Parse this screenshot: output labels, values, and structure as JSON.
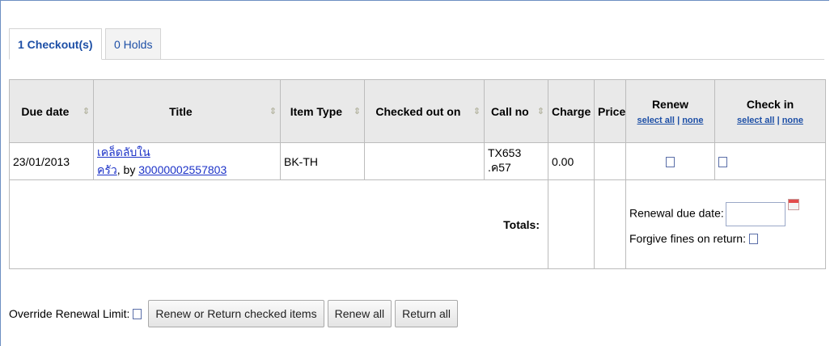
{
  "tabs": [
    {
      "label": "1 Checkout(s)",
      "active": true
    },
    {
      "label": "0 Holds",
      "active": false
    }
  ],
  "table": {
    "headers": {
      "due_date": "Due date",
      "title": "Title",
      "item_type": "Item Type",
      "checked_out_on": "Checked out on",
      "call_no": "Call no",
      "charge": "Charge",
      "price": "Price",
      "renew": "Renew",
      "check_in": "Check in",
      "select_all": "select all",
      "separator": "|",
      "none": "none"
    },
    "rows": [
      {
        "due_date": "23/01/2013",
        "title": "เคล็ดลับในครัว",
        "by": ", by ",
        "barcode": "30000002557803",
        "item_type": "BK-TH",
        "checked_out_on": "",
        "call_no": "TX653 .ค57",
        "charge": "0.00",
        "price": ""
      }
    ],
    "totals_label": "Totals:",
    "renewal_due_date_label": "Renewal due date:",
    "forgive_fines_label": "Forgive fines on return:"
  },
  "footer": {
    "override_label": "Override Renewal Limit:",
    "buttons": {
      "renew_or_return": "Renew or Return checked items",
      "renew_all": "Renew all",
      "return_all": "Return all"
    }
  },
  "icons": {
    "sort": "sort-icon",
    "calendar": "calendar-icon",
    "checkbox": "checkbox"
  },
  "colors": {
    "link": "#1d33c8",
    "tab_text": "#1d4fa6",
    "header_bg": "#e9e9e9",
    "frame_border": "#6d8fc2"
  }
}
